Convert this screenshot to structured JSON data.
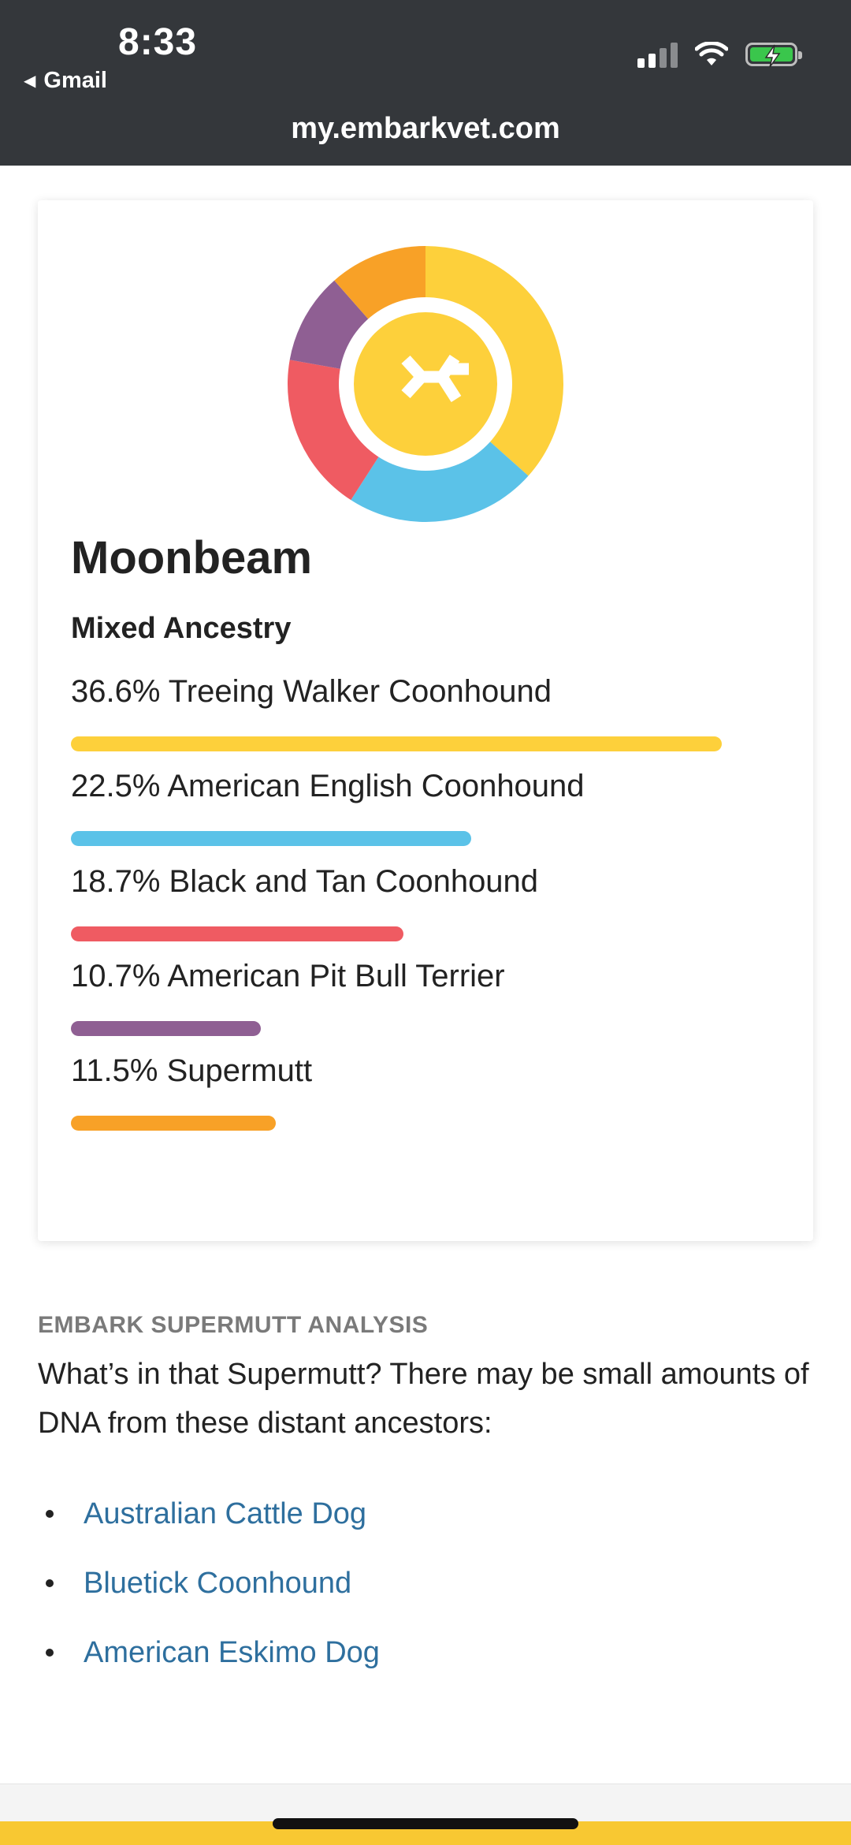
{
  "status_bar": {
    "time": "8:33",
    "back_app": "Gmail",
    "signal_icon": "cellular-signal-icon",
    "wifi_icon": "wifi-icon",
    "battery_icon": "battery-charging-icon"
  },
  "browser": {
    "url": "my.embarkvet.com"
  },
  "profile": {
    "name": "Moonbeam",
    "ancestry_title": "Mixed Ancestry",
    "logo_icon": "embark-logo-icon"
  },
  "ancestry": [
    {
      "label": "36.6% Treeing Walker Coonhound",
      "percent": 36.6,
      "color": "#FDD03B"
    },
    {
      "label": "22.5% American English Coonhound",
      "percent": 22.5,
      "color": "#5BC2E8"
    },
    {
      "label": "18.7% Black and Tan Coonhound",
      "percent": 18.7,
      "color": "#EF5B62"
    },
    {
      "label": "10.7% American Pit Bull Terrier",
      "percent": 10.7,
      "color": "#8F5F93"
    },
    {
      "label": "11.5% Supermutt",
      "percent": 11.5,
      "color": "#F8A127"
    }
  ],
  "supermutt": {
    "section_label": "EMBARK SUPERMUTT ANALYSIS",
    "intro": "What’s in that Supermutt? There may be small amounts of DNA from these distant ancestors:",
    "links": [
      "Australian Cattle Dog",
      "Bluetick Coonhound",
      "American Eskimo Dog"
    ]
  }
}
